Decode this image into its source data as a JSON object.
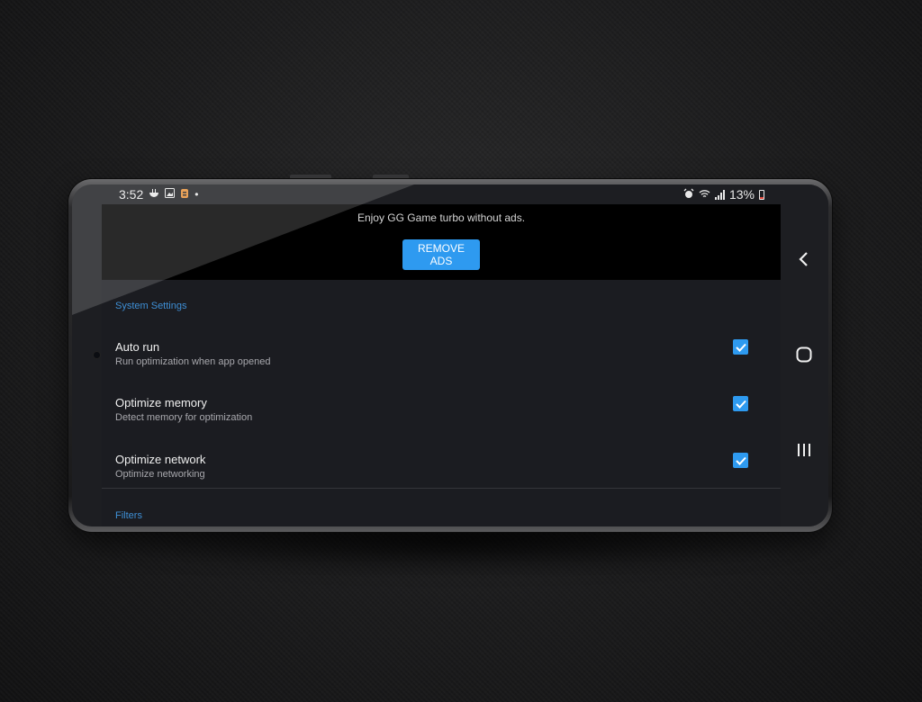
{
  "status_bar": {
    "time": "3:52",
    "left_icons": [
      "ramen-bowl-icon",
      "gallery-icon",
      "app-notification-icon",
      "dot-icon"
    ],
    "right_icons": [
      "alarm-icon",
      "wifi-icon",
      "signal-icon"
    ],
    "battery_percent": "13%",
    "dot": "•"
  },
  "ad": {
    "message": "Enjoy GG Game turbo without ads.",
    "button_label": "REMOVE ADS"
  },
  "system_settings": {
    "section_label": "System Settings",
    "items": [
      {
        "title": "Auto run",
        "subtitle": "Run optimization when app opened",
        "checked": true
      },
      {
        "title": "Optimize memory",
        "subtitle": "Detect memory for optimization",
        "checked": true
      },
      {
        "title": "Optimize network",
        "subtitle": "Optimize networking",
        "checked": true
      }
    ]
  },
  "filters": {
    "section_label": "Filters"
  },
  "nav_bar": {
    "buttons": [
      "back-icon",
      "home-icon",
      "recents-icon"
    ]
  },
  "colors": {
    "accent": "#2e9af0",
    "section_label": "#3e8fd6",
    "background": "#1b1c21",
    "banner": "#000000"
  }
}
